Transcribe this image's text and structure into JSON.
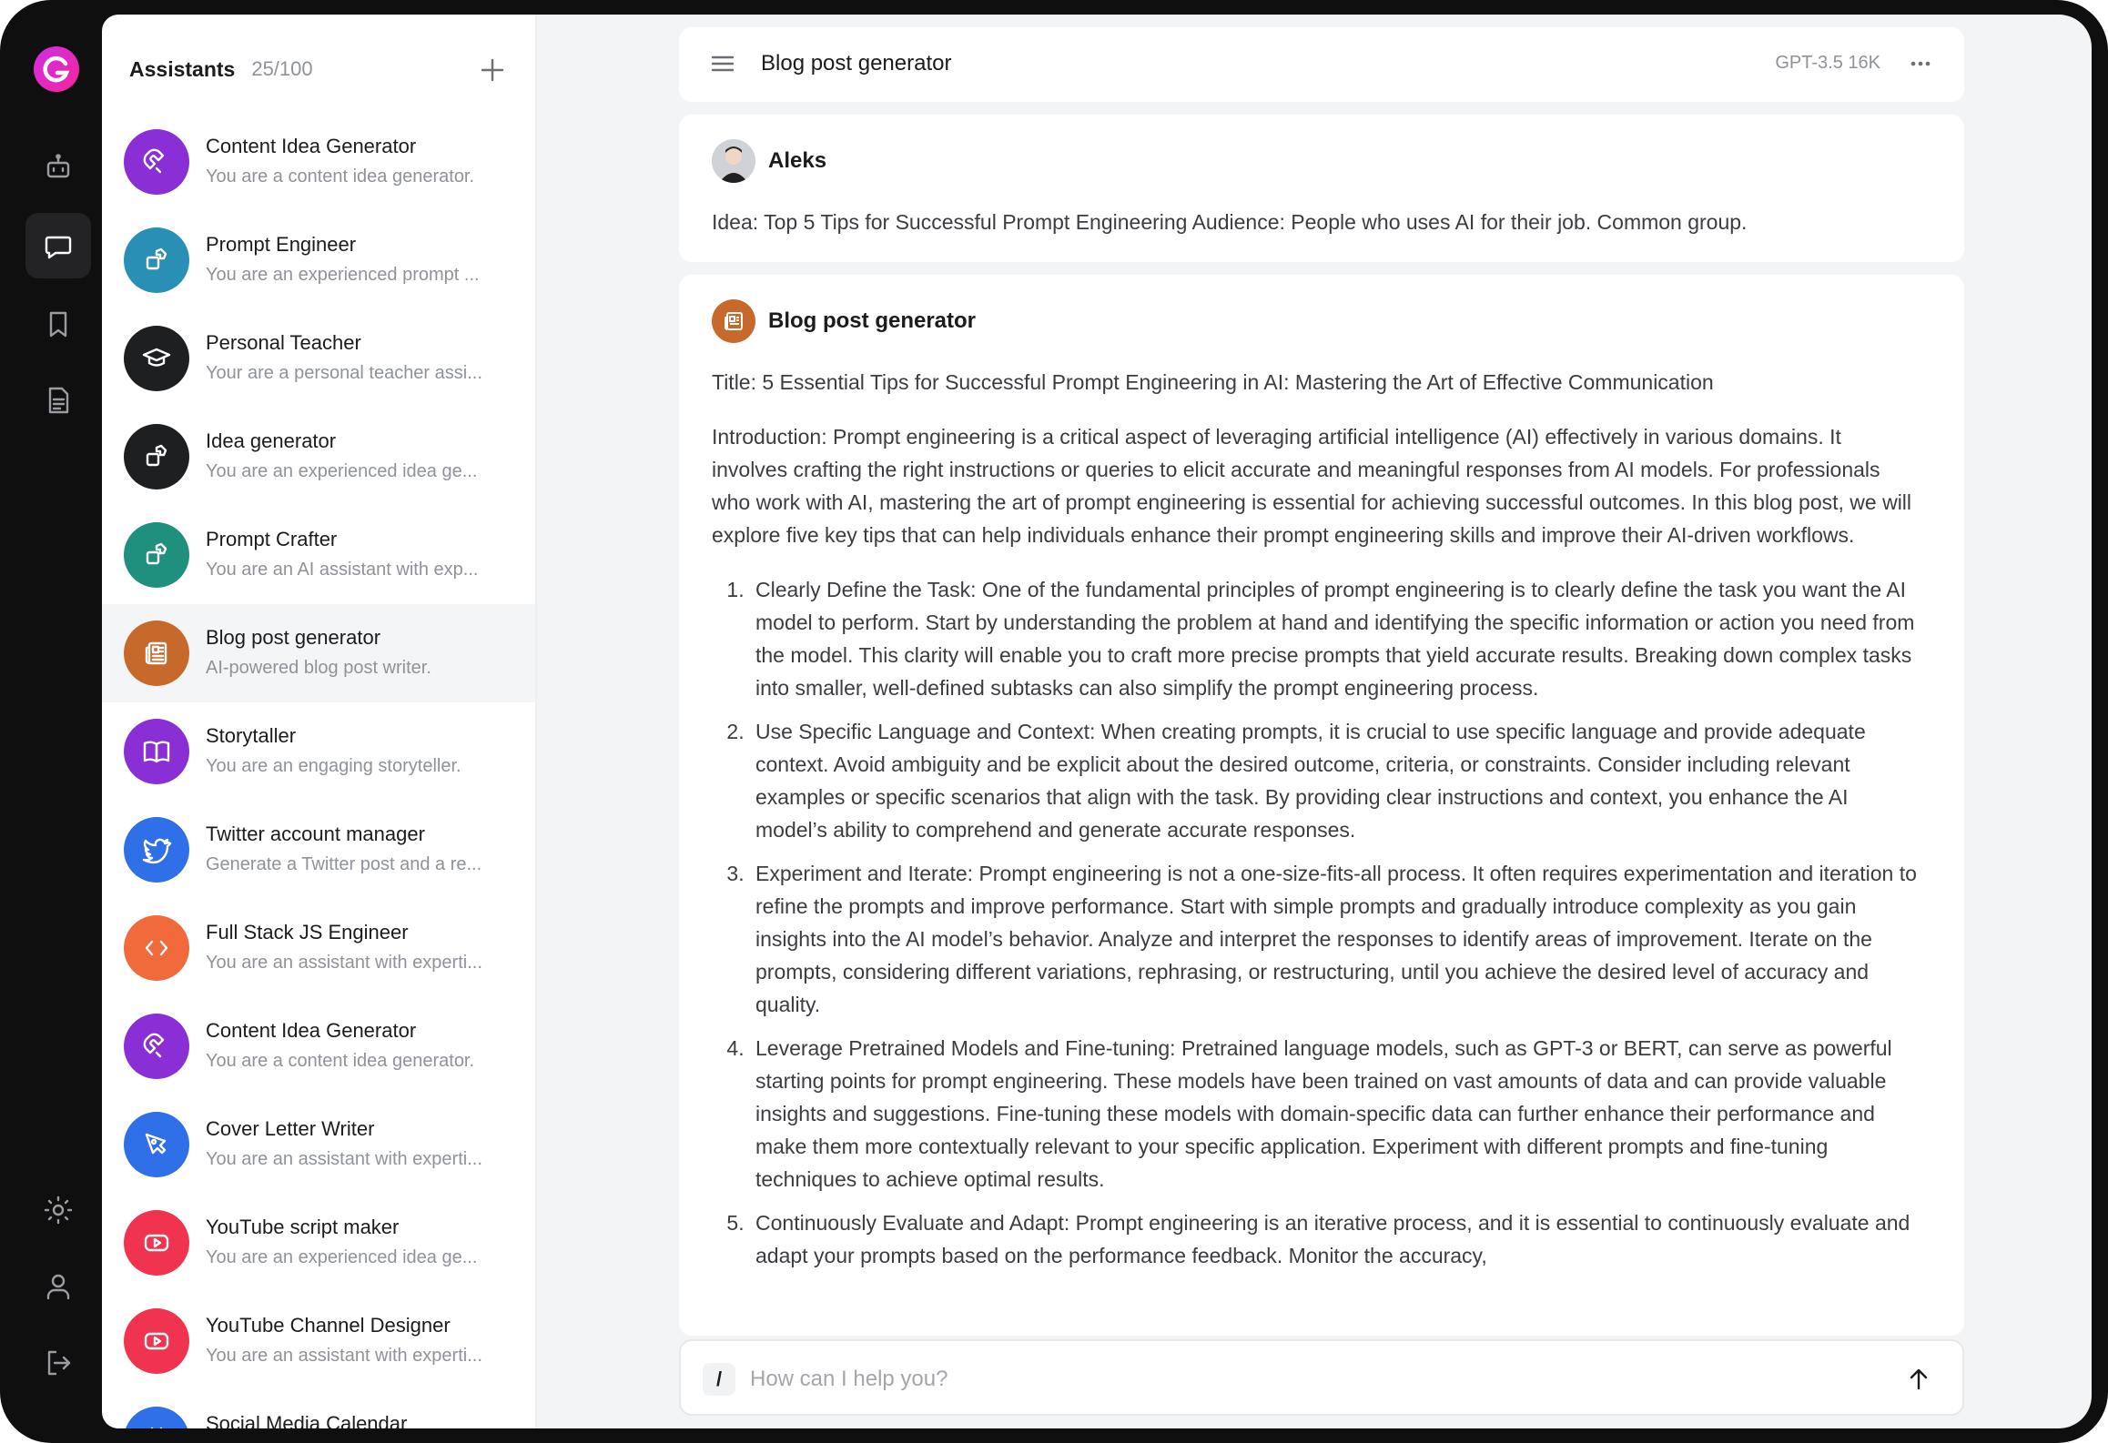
{
  "rail": {
    "logo_icon": "g-logo-icon",
    "items": [
      {
        "icon": "robot-icon",
        "active": false
      },
      {
        "icon": "chat-bubble-icon",
        "active": true
      },
      {
        "icon": "bookmark-icon",
        "active": false
      },
      {
        "icon": "document-icon",
        "active": false
      }
    ],
    "bottom": [
      {
        "icon": "sun-icon"
      },
      {
        "icon": "user-icon"
      },
      {
        "icon": "logout-icon"
      }
    ]
  },
  "sidebar": {
    "title": "Assistants",
    "count": "25/100",
    "add_icon": "plus-icon",
    "items": [
      {
        "name": "Content Idea Generator",
        "desc": "You are a content idea generator.",
        "color": "#8a2fd6",
        "icon": "magnet-icon"
      },
      {
        "name": "Prompt Engineer",
        "desc": "You are an experienced prompt ...",
        "color": "#2a8fb5",
        "icon": "puzzle-icon"
      },
      {
        "name": "Personal Teacher",
        "desc": "Your are a personal teacher assi...",
        "color": "#1e1f21",
        "icon": "graduation-cap-icon"
      },
      {
        "name": "Idea generator",
        "desc": "You are an experienced idea ge...",
        "color": "#1e1f21",
        "icon": "puzzle-icon"
      },
      {
        "name": "Prompt Crafter",
        "desc": "You are an AI assistant with exp...",
        "color": "#1f8f7e",
        "icon": "puzzle-icon"
      },
      {
        "name": "Blog post generator",
        "desc": "AI-powered blog post writer.",
        "color": "#c8692c",
        "icon": "newspaper-icon",
        "active": true
      },
      {
        "name": "Storytaller",
        "desc": "You are an engaging storyteller.",
        "color": "#8a2fd6",
        "icon": "open-book-icon"
      },
      {
        "name": "Twitter account manager",
        "desc": "Generate a Twitter post and a re...",
        "color": "#2f6fe8",
        "icon": "twitter-bird-icon"
      },
      {
        "name": "Full Stack JS Engineer",
        "desc": "You are an assistant with experti...",
        "color": "#f06a3c",
        "icon": "code-brackets-icon"
      },
      {
        "name": "Content Idea Generator",
        "desc": "You are a content idea generator.",
        "color": "#8a2fd6",
        "icon": "magnet-icon"
      },
      {
        "name": "Cover Letter Writer",
        "desc": "You are an assistant with experti...",
        "color": "#2f6fe8",
        "icon": "pen-nib-icon"
      },
      {
        "name": "YouTube script maker",
        "desc": "You are an experienced idea ge...",
        "color": "#f0334f",
        "icon": "youtube-icon"
      },
      {
        "name": "YouTube Channel Designer",
        "desc": "You are an assistant with experti...",
        "color": "#f0334f",
        "icon": "youtube-icon"
      },
      {
        "name": "Social Media Calendar",
        "desc": "",
        "color": "#2f6fe8",
        "icon": "calendar-icon"
      }
    ]
  },
  "topbar": {
    "menu_icon": "hamburger-menu-icon",
    "title": "Blog post generator",
    "model": "GPT-3.5 16K",
    "more_icon": "more-horizontal-icon"
  },
  "messages": {
    "user": {
      "author": "Aleks",
      "text": "Idea: Top 5 Tips for Successful Prompt Engineering Audience: People who uses AI for their job. Common group."
    },
    "bot": {
      "author": "Blog post generator",
      "title": "Title: 5 Essential Tips for Successful Prompt Engineering in AI: Mastering the Art of Effective Communication",
      "intro": "Introduction: Prompt engineering is a critical aspect of leveraging artificial intelligence (AI) effectively in various domains. It involves crafting the right instructions or queries to elicit accurate and meaningful responses from AI models. For professionals who work with AI, mastering the art of prompt engineering is essential for achieving successful outcomes. In this blog post, we will explore five key tips that can help individuals enhance their prompt engineering skills and improve their AI-driven workflows.",
      "tips": [
        "Clearly Define the Task: One of the fundamental principles of prompt engineering is to clearly define the task you want the AI model to perform. Start by understanding the problem at hand and identifying the specific information or action you need from the model. This clarity will enable you to craft more precise prompts that yield accurate results. Breaking down complex tasks into smaller, well-defined subtasks can also simplify the prompt engineering process.",
        "Use Specific Language and Context: When creating prompts, it is crucial to use specific language and provide adequate context. Avoid ambiguity and be explicit about the desired outcome, criteria, or constraints. Consider including relevant examples or specific scenarios that align with the task. By providing clear instructions and context, you enhance the AI model’s ability to comprehend and generate accurate responses.",
        "Experiment and Iterate: Prompt engineering is not a one-size-fits-all process. It often requires experimentation and iteration to refine the prompts and improve performance. Start with simple prompts and gradually introduce complexity as you gain insights into the AI model’s behavior. Analyze and interpret the responses to identify areas of improvement. Iterate on the prompts, considering different variations, rephrasing, or restructuring, until you achieve the desired level of accuracy and quality.",
        "Leverage Pretrained Models and Fine-tuning: Pretrained language models, such as GPT-3 or BERT, can serve as powerful starting points for prompt engineering. These models have been trained on vast amounts of data and can provide valuable insights and suggestions. Fine-tuning these models with domain-specific data can further enhance their performance and make them more contextually relevant to your specific application. Experiment with different prompts and fine-tuning techniques to achieve optimal results.",
        "Continuously Evaluate and Adapt: Prompt engineering is an iterative process, and it is essential to continuously evaluate and adapt your prompts based on the performance feedback. Monitor the accuracy,"
      ]
    }
  },
  "composer": {
    "slash": "/",
    "placeholder": "How can I help you?",
    "value": "",
    "send_icon": "arrow-up-icon"
  }
}
